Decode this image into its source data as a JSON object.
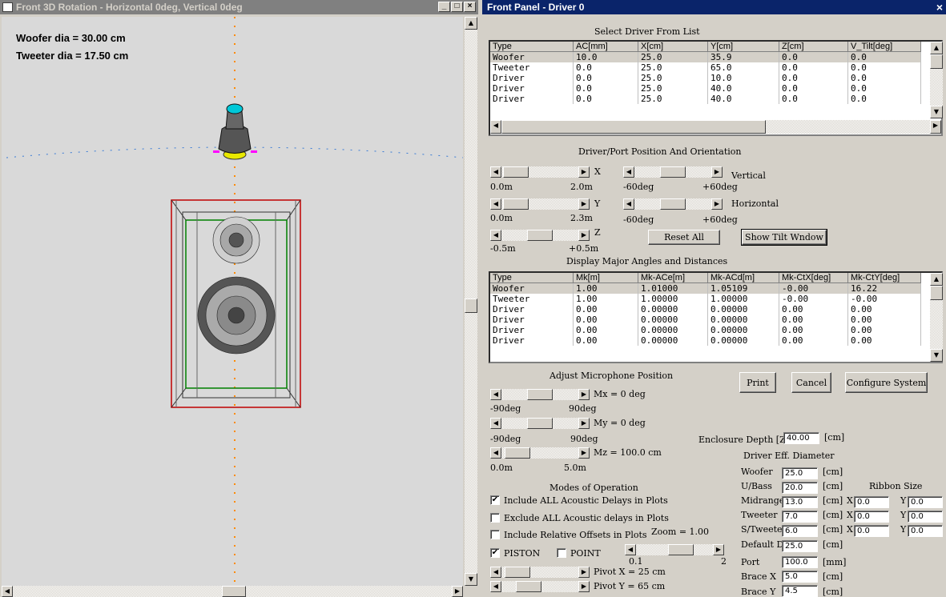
{
  "viewer": {
    "title": "Front 3D Rotation - Horizontal 0deg, Vertical 0deg",
    "woofer_label": "Woofer dia = 30.00 cm",
    "tweeter_label": "Tweeter dia = 17.50 cm"
  },
  "panel": {
    "title": "Front Panel - Driver 0",
    "close": "×",
    "driver_list_title": "Select Driver From List",
    "drivers": {
      "columns": [
        "Type",
        "AC[mm]",
        "X[cm]",
        "Y[cm]",
        "Z[cm]",
        "V_Tilt[deg]"
      ],
      "rows": [
        [
          "Woofer",
          "10.0",
          "25.0",
          "35.9",
          "0.0",
          "0.0"
        ],
        [
          "Tweeter",
          "0.0",
          "25.0",
          "65.0",
          "0.0",
          "0.0"
        ],
        [
          "Driver",
          "0.0",
          "25.0",
          "10.0",
          "0.0",
          "0.0"
        ],
        [
          "Driver",
          "0.0",
          "25.0",
          "40.0",
          "0.0",
          "0.0"
        ],
        [
          "Driver",
          "0.0",
          "25.0",
          "40.0",
          "0.0",
          "0.0"
        ]
      ]
    },
    "position_title": "Driver/Port Position And Orientation",
    "x_label": "X",
    "x_min": "0.0m",
    "x_max": "2.0m",
    "y_label": "Y",
    "y_min": "0.0m",
    "y_max": "2.3m",
    "z_label": "Z",
    "z_min": "-0.5m",
    "z_max": "+0.5m",
    "vertical_label": "Vertical",
    "v_min": "-60deg",
    "v_max": "+60deg",
    "horizontal_label": "Horizontal",
    "h_min": "-60deg",
    "h_max": "+60deg",
    "reset_all": "Reset All",
    "show_tilt": "Show Tilt Wndow",
    "angles_title": "Display Major Angles and Distances",
    "angles": {
      "columns": [
        "Type",
        "Mk[m]",
        "Mk-ACe[m]",
        "Mk-ACd[m]",
        "Mk-CtX[deg]",
        "Mk-CtY[deg]"
      ],
      "rows": [
        [
          "Woofer",
          "1.00",
          "1.01000",
          "1.05109",
          "-0.00",
          "16.22"
        ],
        [
          "Tweeter",
          "1.00",
          "1.00000",
          "1.00000",
          "-0.00",
          "-0.00"
        ],
        [
          "Driver",
          "0.00",
          "0.00000",
          "0.00000",
          "0.00",
          "0.00"
        ],
        [
          "Driver",
          "0.00",
          "0.00000",
          "0.00000",
          "0.00",
          "0.00"
        ],
        [
          "Driver",
          "0.00",
          "0.00000",
          "0.00000",
          "0.00",
          "0.00"
        ],
        [
          "Driver",
          "0.00",
          "0.00000",
          "0.00000",
          "0.00",
          "0.00"
        ]
      ]
    },
    "mic_title": "Adjust Microphone Position",
    "mx_label": "Mx = 0 deg",
    "mx_min": "-90deg",
    "mx_max": "90deg",
    "my_label": "My = 0 deg",
    "my_min": "-90deg",
    "my_max": "90deg",
    "mz_label": "Mz = 100.0 cm",
    "mz_min": "0.0m",
    "mz_max": "5.0m",
    "print": "Print",
    "cancel": "Cancel",
    "configure": "Configure System",
    "enclosure_depth_label": "Enclosure Depth [Z]",
    "enclosure_depth_value": "40.00",
    "cm": "[cm]",
    "mm": "[mm]",
    "modes_title": "Modes of Operation",
    "mode_include_all": "Include ALL Acoustic Delays in Plots",
    "mode_exclude_all": "Exclude ALL Acoustic delays in Plots",
    "mode_relative": "Include Relative Offsets in Plots",
    "zoom_label": "Zoom = 1.00",
    "zoom_min": "0.1",
    "zoom_max": "2",
    "piston": "PISTON",
    "point": "POINT",
    "pivot_x": "Pivot X = 25 cm",
    "pivot_y": "Pivot Y = 65 cm",
    "eff_title": "Driver Eff. Diameter",
    "eff": [
      {
        "label": "Woofer",
        "value": "25.0"
      },
      {
        "label": "U/Bass",
        "value": "20.0"
      },
      {
        "label": "Midrange",
        "value": "13.0"
      },
      {
        "label": "Tweeter",
        "value": "7.0"
      },
      {
        "label": "S/Tweeter",
        "value": "6.0"
      },
      {
        "label": "Default D",
        "value": "25.0"
      }
    ],
    "port_label": "Port",
    "port_value": "100.0",
    "brace_x_label": "Brace X",
    "brace_x_value": "5.0",
    "brace_y_label": "Brace Y",
    "brace_y_value": "4.5",
    "ribbon_title": "Ribbon Size",
    "ribbon": [
      {
        "x": "0.0",
        "y": "0.0"
      },
      {
        "x": "0.0",
        "y": "0.0"
      },
      {
        "x": "0.0",
        "y": "0.0"
      }
    ],
    "x_short": "X",
    "y_short": "Y"
  }
}
